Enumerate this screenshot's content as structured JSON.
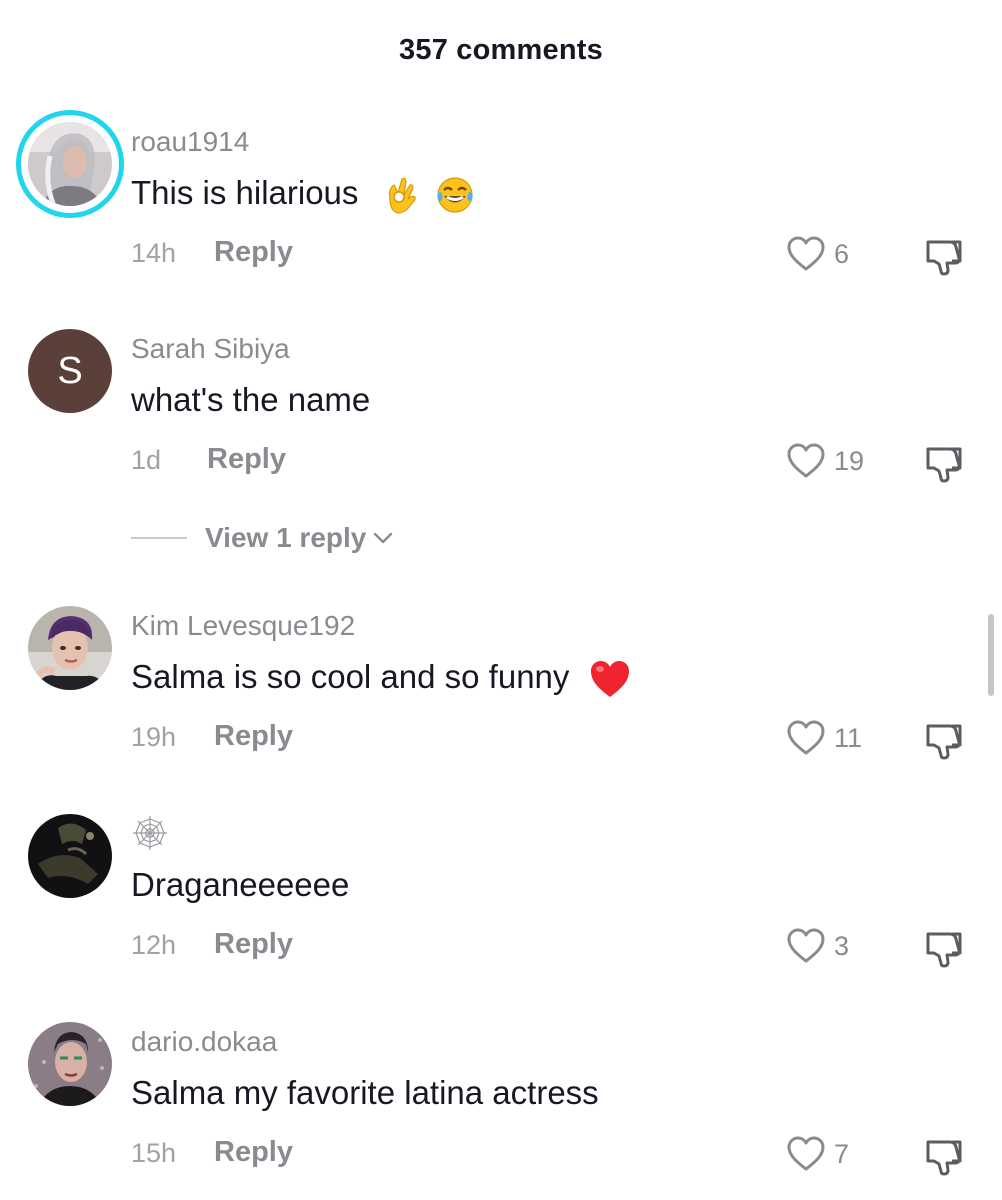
{
  "header": {
    "title": "357 comments"
  },
  "comments": [
    {
      "username": "roau1914",
      "text": "This is hilarious",
      "emojis": [
        "ok-hand-emoji",
        "tears-of-joy-emoji"
      ],
      "time": "14h",
      "reply_label": "Reply",
      "likes": "6",
      "avatar": "photo-with-story-ring",
      "story_ring_color": "#20d5ec"
    },
    {
      "username": "Sarah Sibiya",
      "text": "what's the name",
      "time": "1d",
      "reply_label": "Reply",
      "likes": "19",
      "avatar_letter": "S",
      "avatar_color": "#5a4038",
      "view_replies": "View 1 reply"
    },
    {
      "username": "Kim Levesque192",
      "text": "Salma is so cool and so funny",
      "emojis": [
        "red-heart-emoji"
      ],
      "time": "19h",
      "reply_label": "Reply",
      "likes": "11",
      "avatar": "photo"
    },
    {
      "username_icon": "spider-web-icon",
      "text": "Draganeeeeee",
      "time": "12h",
      "reply_label": "Reply",
      "likes": "3",
      "avatar": "photo-dark"
    },
    {
      "username": "dario.dokaa",
      "text": "Salma my favorite latina actress",
      "time": "15h",
      "reply_label": "Reply",
      "likes": "7",
      "avatar": "photo"
    }
  ],
  "icons": {
    "like": "heart-outline-icon",
    "dislike": "thumbs-down-icon",
    "expand": "chevron-down-icon"
  },
  "colors": {
    "text_primary": "#161823",
    "text_secondary": "#8a8b91",
    "accent_ring": "#20d5ec"
  }
}
